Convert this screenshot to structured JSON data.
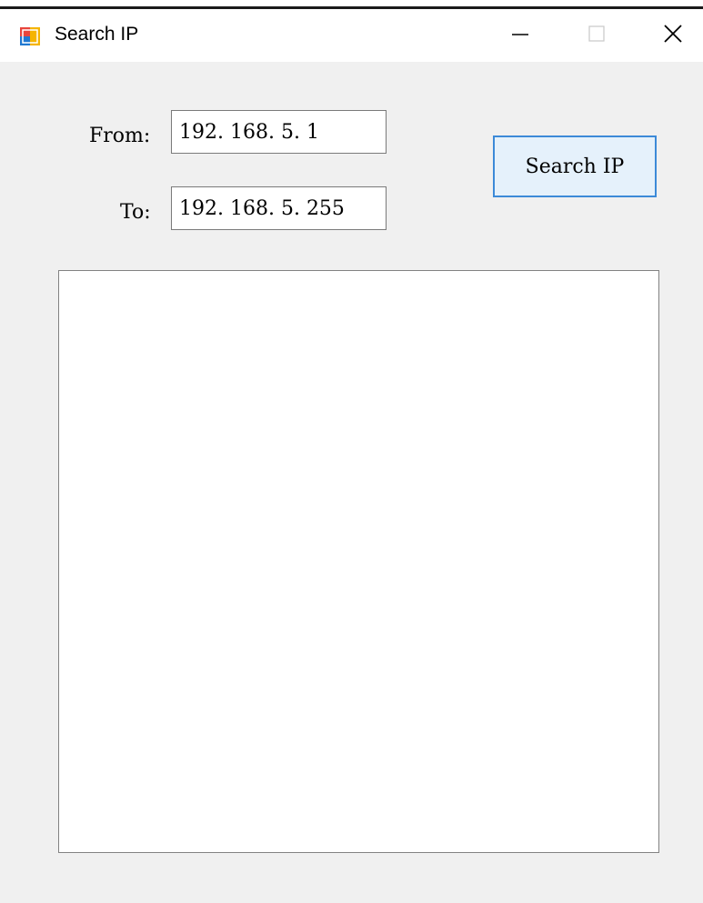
{
  "window": {
    "title": "Search IP",
    "icon": "winforms-app-icon",
    "controls": {
      "minimize": "minimize-icon",
      "maximize": "maximize-icon",
      "close": "close-icon"
    }
  },
  "form": {
    "from_label": "From:",
    "from_value": "192. 168. 5. 1",
    "to_label": "To:",
    "to_value": "192. 168. 5. 255",
    "search_button": "Search IP"
  },
  "results": {
    "items": []
  },
  "colors": {
    "window_bg": "#f0f0f0",
    "button_bg": "#e5f1fb",
    "button_border": "#3c8ad8"
  }
}
